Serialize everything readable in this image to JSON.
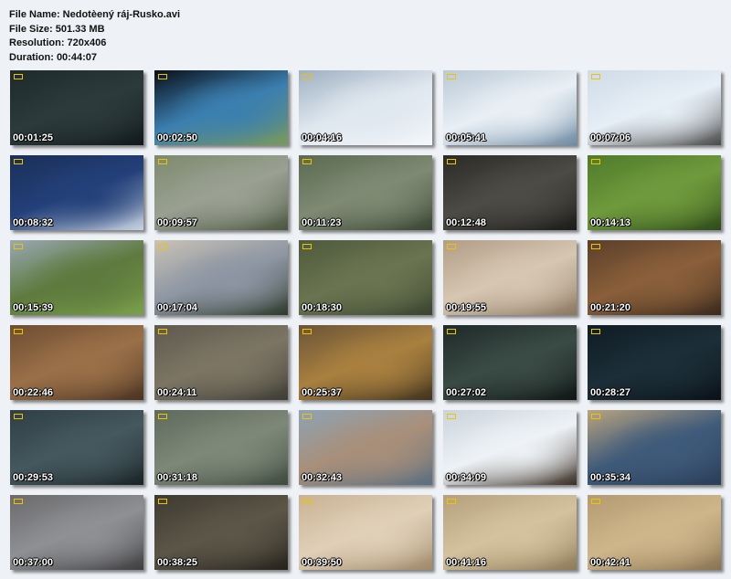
{
  "file_info": {
    "name_line": "File Name: Nedotèený ráj-Rusko.avi",
    "size_line": "File Size: 501.33 MB",
    "resolution_line": "Resolution: 720x406",
    "duration_line": "Duration: 00:44:07"
  },
  "thumbnails": [
    {
      "time": "00:01:25",
      "colors": [
        "#1e2a2c",
        "#2c3a3c",
        "#11191b"
      ]
    },
    {
      "time": "00:02:50",
      "colors": [
        "#0a0f1a",
        "#3b7fb0",
        "#7a9a5a"
      ]
    },
    {
      "time": "00:04:16",
      "colors": [
        "#9fb0c2",
        "#dfe7ef",
        "#f4f7fb"
      ]
    },
    {
      "time": "00:05:41",
      "colors": [
        "#b9c9d6",
        "#e9eff5",
        "#6d8aa3"
      ]
    },
    {
      "time": "00:07:06",
      "colors": [
        "#cfdbe7",
        "#e6eef6",
        "#4a4a4a"
      ]
    },
    {
      "time": "00:08:32",
      "colors": [
        "#1b2f57",
        "#23407a",
        "#c9d4e2"
      ]
    },
    {
      "time": "00:09:57",
      "colors": [
        "#7d8a6e",
        "#9aa092",
        "#4b5640"
      ]
    },
    {
      "time": "00:11:23",
      "colors": [
        "#5c6a52",
        "#7e8a73",
        "#3a4433"
      ]
    },
    {
      "time": "00:12:48",
      "colors": [
        "#2a2a27",
        "#4d4b45",
        "#1c1b19"
      ]
    },
    {
      "time": "00:14:13",
      "colors": [
        "#4f7a2b",
        "#6f9a3c",
        "#2e4a1a"
      ]
    },
    {
      "time": "00:15:39",
      "colors": [
        "#9aa8b4",
        "#5e7a3e",
        "#7aa04a"
      ]
    },
    {
      "time": "00:17:04",
      "colors": [
        "#c9c2b6",
        "#8d96a3",
        "#2f3a2c"
      ]
    },
    {
      "time": "00:18:30",
      "colors": [
        "#4f5a3d",
        "#6a7450",
        "#3a4430"
      ]
    },
    {
      "time": "00:19:55",
      "colors": [
        "#b29d86",
        "#d6c6b2",
        "#8c7760"
      ]
    },
    {
      "time": "00:21:20",
      "colors": [
        "#5a3f2a",
        "#8a5f3a",
        "#3a2a1c"
      ]
    },
    {
      "time": "00:22:46",
      "colors": [
        "#6e4d32",
        "#9a7048",
        "#4a3322"
      ]
    },
    {
      "time": "00:24:11",
      "colors": [
        "#5e5a4e",
        "#7c7564",
        "#3e3c34"
      ]
    },
    {
      "time": "00:25:37",
      "colors": [
        "#6a5438",
        "#a9803f",
        "#40331f"
      ]
    },
    {
      "time": "00:27:02",
      "colors": [
        "#1f2a2a",
        "#3a4a44",
        "#0f1616"
      ]
    },
    {
      "time": "00:28:27",
      "colors": [
        "#0f1c24",
        "#1c2e38",
        "#0a1218"
      ]
    },
    {
      "time": "00:29:53",
      "colors": [
        "#2e3e44",
        "#45585e",
        "#1a2428"
      ]
    },
    {
      "time": "00:31:18",
      "colors": [
        "#5e6a5c",
        "#7d8878",
        "#3e4a3e"
      ]
    },
    {
      "time": "00:32:43",
      "colors": [
        "#8ea3b4",
        "#a88f7a",
        "#5a6e80"
      ]
    },
    {
      "time": "00:34:09",
      "colors": [
        "#c9d3dc",
        "#eef2f6",
        "#3a2e24"
      ]
    },
    {
      "time": "00:35:34",
      "colors": [
        "#b9a480",
        "#3f5a7a",
        "#2a3e58"
      ]
    },
    {
      "time": "00:37:00",
      "colors": [
        "#6a6a6c",
        "#8f9094",
        "#3e3e40"
      ]
    },
    {
      "time": "00:38:25",
      "colors": [
        "#3e3a30",
        "#5c5648",
        "#26231c"
      ]
    },
    {
      "time": "00:39:50",
      "colors": [
        "#c9b294",
        "#e0d0b8",
        "#a08868"
      ]
    },
    {
      "time": "00:41:16",
      "colors": [
        "#b5a07c",
        "#d4c29e",
        "#8e7a58"
      ]
    },
    {
      "time": "00:42:41",
      "colors": [
        "#b49a72",
        "#cfb68a",
        "#8a7352"
      ]
    }
  ]
}
